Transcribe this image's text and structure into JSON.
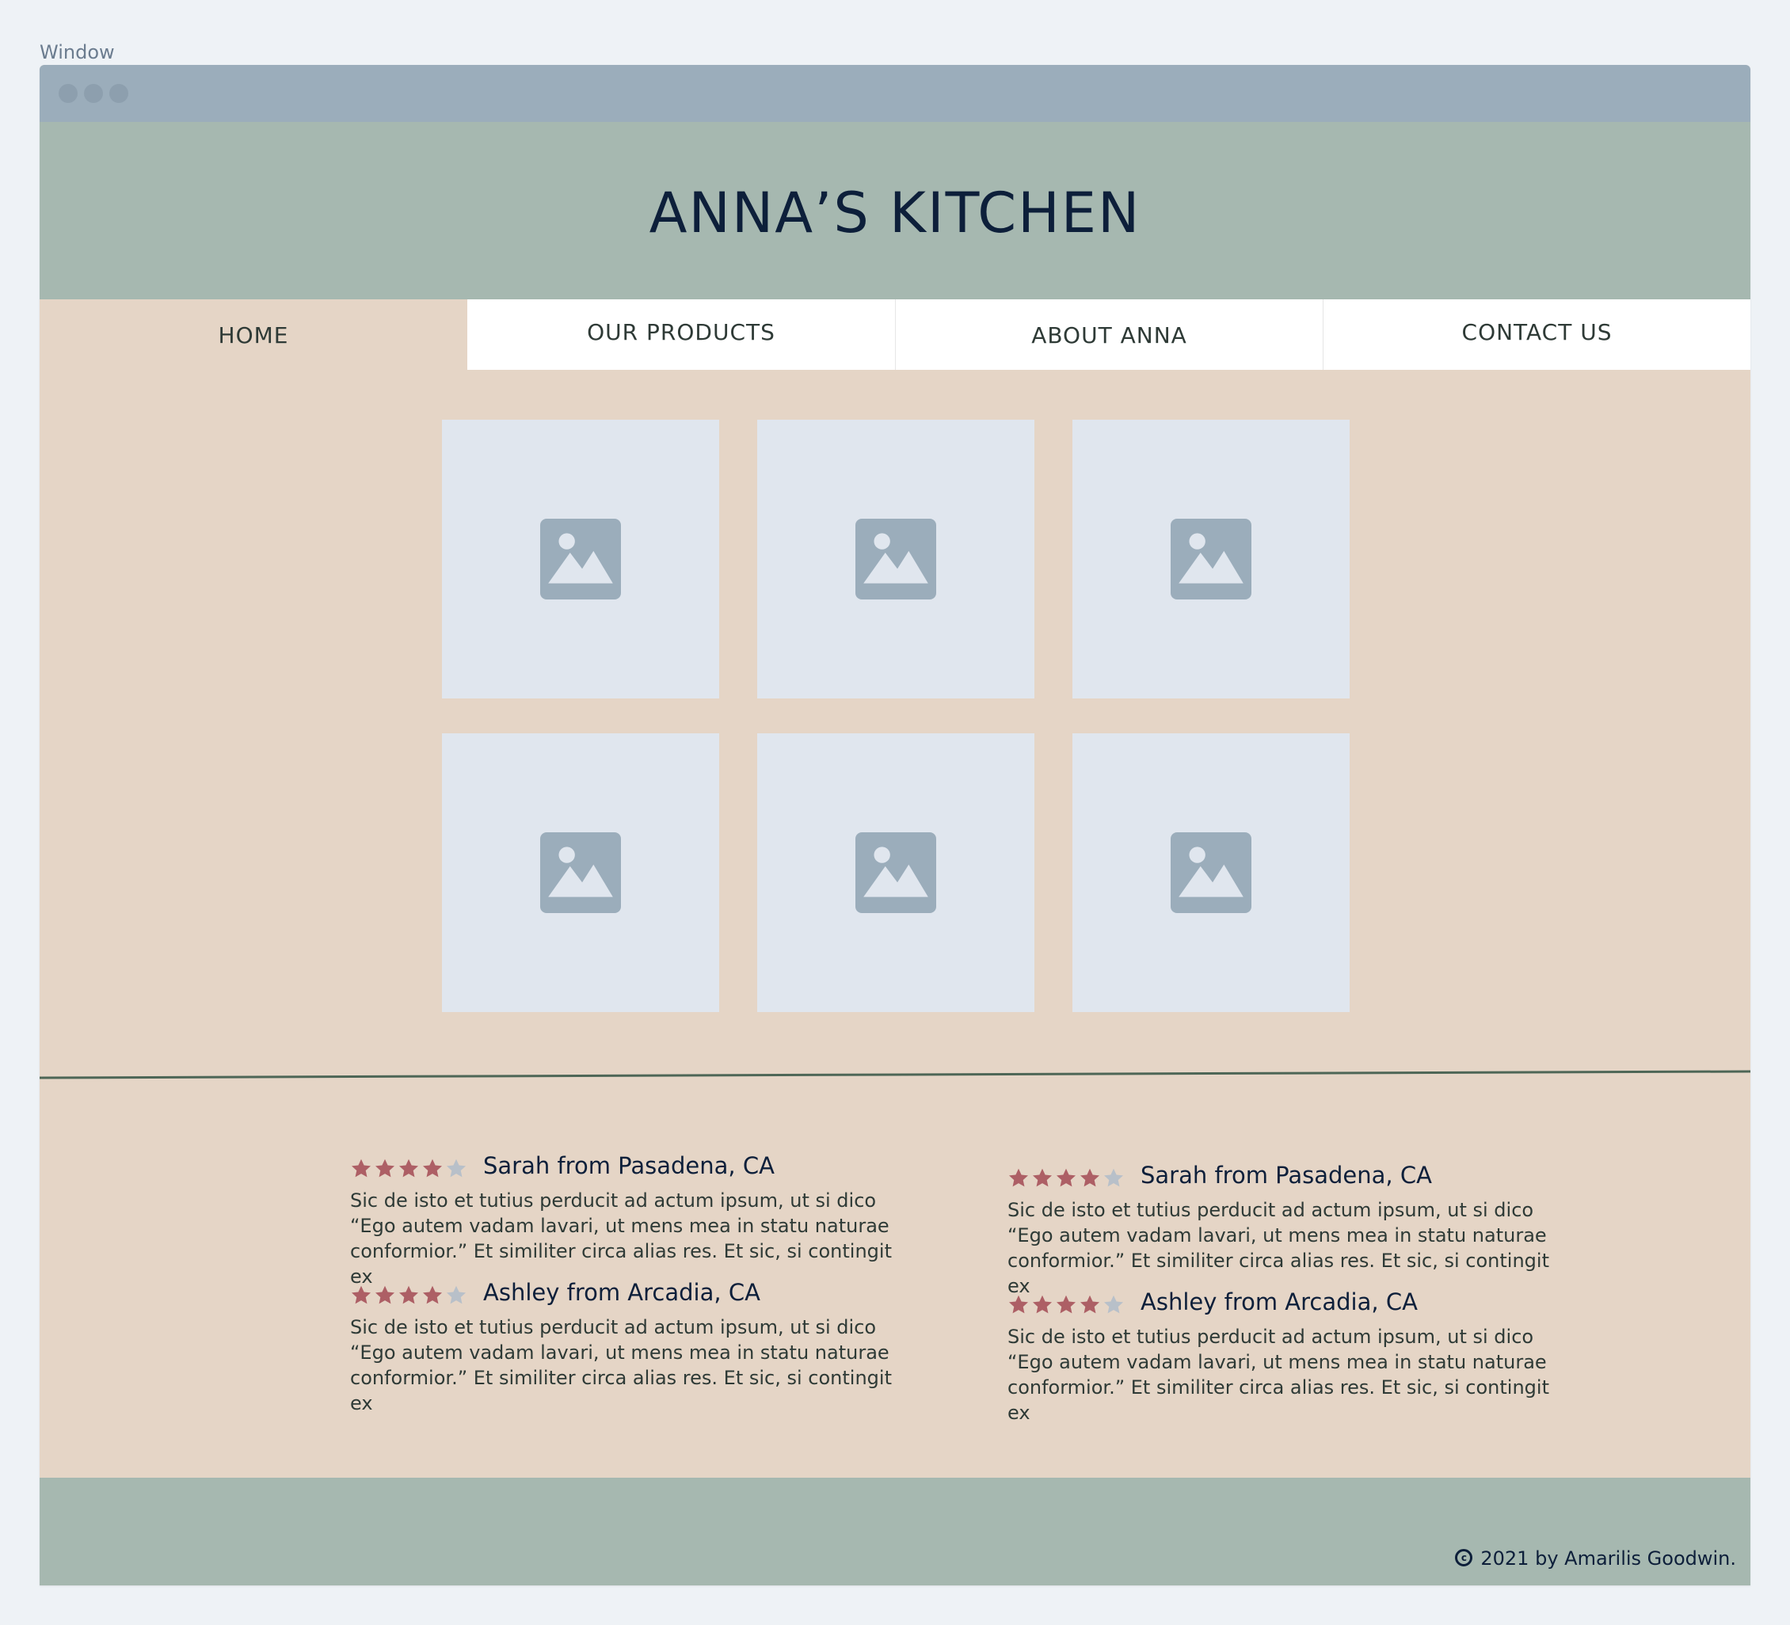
{
  "window": {
    "label": "Window"
  },
  "header": {
    "site_title": "ANNA’S KITCHEN"
  },
  "nav": {
    "items": [
      {
        "label": "HOME",
        "active": true
      },
      {
        "label": "OUR PRODUCTS",
        "active": false
      },
      {
        "label": "ABOUT ANNA",
        "active": false
      },
      {
        "label": "CONTACT US",
        "active": false
      }
    ]
  },
  "gallery": {
    "images": [
      {
        "icon": "image-placeholder-icon"
      },
      {
        "icon": "image-placeholder-icon"
      },
      {
        "icon": "image-placeholder-icon"
      },
      {
        "icon": "image-placeholder-icon"
      },
      {
        "icon": "image-placeholder-icon"
      },
      {
        "icon": "image-placeholder-icon"
      }
    ]
  },
  "reviews": [
    {
      "name": "Sarah from Pasadena, CA",
      "rating": 4,
      "max_rating": 5,
      "text": "Sic de isto et tutius perducit ad actum ipsum, ut si dico “Ego autem vadam lavari, ut mens mea in statu naturae conformior.” Et similiter circa alias res. Et sic, si contingit ex"
    },
    {
      "name": "Ashley from Arcadia, CA",
      "rating": 4,
      "max_rating": 5,
      "text": "Sic de isto et tutius perducit ad actum ipsum, ut si dico “Ego autem vadam lavari, ut mens mea in statu naturae conformior.” Et similiter circa alias res. Et sic, si contingit ex"
    },
    {
      "name": "Sarah from Pasadena, CA",
      "rating": 4,
      "max_rating": 5,
      "text": "Sic de isto et tutius perducit ad actum ipsum, ut si dico “Ego autem vadam lavari, ut mens mea in statu naturae conformior.” Et similiter circa alias res. Et sic, si contingit ex"
    },
    {
      "name": "Ashley from Arcadia, CA",
      "rating": 4,
      "max_rating": 5,
      "text": "Sic de isto et tutius perducit ad actum ipsum, ut si dico “Ego autem vadam lavari, ut mens mea in statu naturae conformior.” Et similiter circa alias res. Et sic, si contingit ex"
    }
  ],
  "footer": {
    "copyright_text": "2021 by Amarilis Goodwin.",
    "copyright_symbol": "c"
  },
  "colors": {
    "page_bg": "#eef2f6",
    "titlebar": "#9badbb",
    "header_bg": "#a6b8b0",
    "content_bg": "#e5d5c6",
    "nav_bg": "#ffffff",
    "title_text": "#0d1f3a",
    "body_text": "#2e3a36",
    "image_bg": "#e0e6ee",
    "image_icon": "#9badbb",
    "star_filled": "#ad5f65",
    "star_empty": "#b8c0c9",
    "divider": "#4d6656"
  }
}
